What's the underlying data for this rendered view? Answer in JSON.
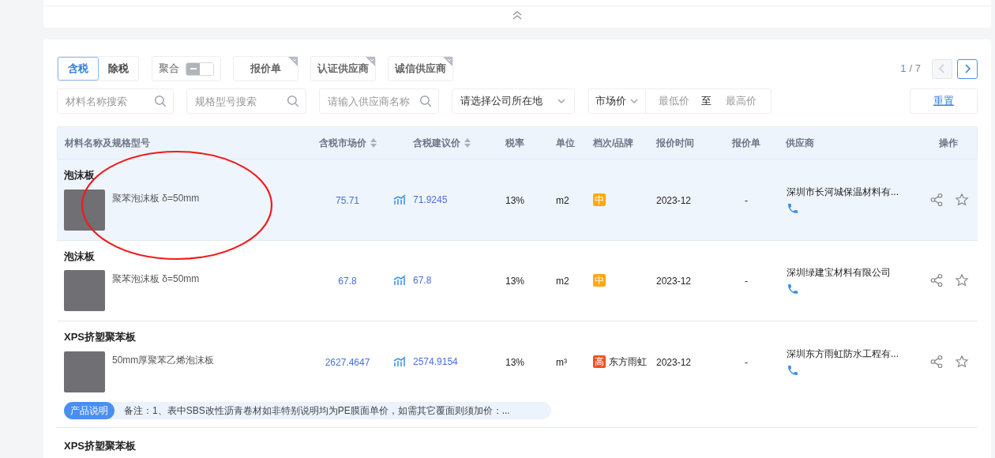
{
  "filters": {
    "tax_tabs": [
      {
        "label": "含税",
        "selected": true
      },
      {
        "label": "除税",
        "selected": false
      }
    ],
    "aggregate": {
      "label": "聚合",
      "on": false
    },
    "toggle_buttons": [
      {
        "label": "报价单"
      },
      {
        "label": "认证供应商"
      },
      {
        "label": "诚信供应商"
      }
    ],
    "pagination": {
      "page": "1",
      "of": "/ 7",
      "prev_disabled": true,
      "next_disabled": false
    },
    "searches": [
      {
        "placeholder": "材料名称搜索"
      },
      {
        "placeholder": "规格型号搜索"
      },
      {
        "placeholder": "请输入供应商名称"
      }
    ],
    "location_select": {
      "value": "请选择公司所在地"
    },
    "price_range": {
      "type": "市场价",
      "min_placeholder": "最低价",
      "separator": "至",
      "max_placeholder": "最高价"
    },
    "reset_button": "重置"
  },
  "table": {
    "columns": [
      {
        "label": "材料名称及规格型号",
        "sortable": false
      },
      {
        "label": "含税市场价",
        "sortable": true
      },
      {
        "label": "含税建议价",
        "sortable": true
      },
      {
        "label": "税率",
        "sortable": false
      },
      {
        "label": "单位",
        "sortable": false
      },
      {
        "label": "档次/品牌",
        "sortable": false
      },
      {
        "label": "报价时间",
        "sortable": false
      },
      {
        "label": "报价单",
        "sortable": false
      },
      {
        "label": "供应商",
        "sortable": false
      },
      {
        "label": "操作",
        "sortable": false
      }
    ],
    "rows": [
      {
        "highlighted": true,
        "name": "泡沫板",
        "spec": "聚苯泡沫板 δ=50mm",
        "market_price": "75.71",
        "suggested_price": "71.9245",
        "tax_rate": "13%",
        "unit": "m2",
        "grade": {
          "label": "中",
          "color": "#ffa814"
        },
        "quote_time": "2023-12",
        "quote_sheet": "-",
        "supplier": "深圳市长河城保温材料有..."
      },
      {
        "highlighted": false,
        "name": "泡沫板",
        "spec": "聚苯泡沫板 δ=50mm",
        "market_price": "67.8",
        "suggested_price": "67.8",
        "tax_rate": "13%",
        "unit": "m2",
        "grade": {
          "label": "中",
          "color": "#ffa814"
        },
        "quote_time": "2023-12",
        "quote_sheet": "-",
        "supplier": "深圳绿建宝材料有限公司"
      },
      {
        "highlighted": false,
        "name": "XPS挤塑聚苯板",
        "spec": "50mm厚聚苯乙烯泡沫板",
        "market_price": "2627.4647",
        "suggested_price": "2574.9154",
        "tax_rate": "13%",
        "unit": "m³",
        "grade": {
          "label": "高",
          "color": "#f4511e"
        },
        "brand": "东方雨虹",
        "quote_time": "2023-12",
        "quote_sheet": "-",
        "supplier": "深圳东方雨虹防水工程有...",
        "note": {
          "label": "产品说明",
          "text": "备注：1、表中SBS改性沥青卷材如非特别说明均为PE膜面单价，如需其它覆面则须加价：..."
        }
      },
      {
        "highlighted": false,
        "name": "XPS挤塑聚苯板"
      }
    ]
  }
}
